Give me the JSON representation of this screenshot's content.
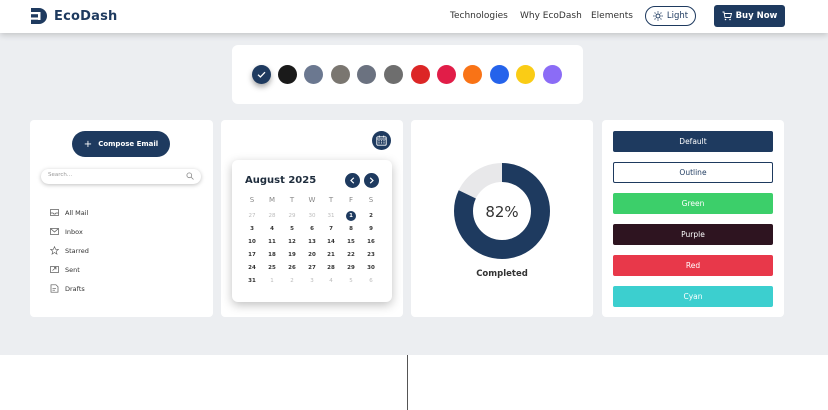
{
  "brand": {
    "name": "EcoDash"
  },
  "nav": {
    "links": [
      "Technologies",
      "Why EcoDash",
      "Elements"
    ],
    "theme_toggle": "Light",
    "buy_button": "Buy Now"
  },
  "colors": {
    "primary": "#1e3a5f",
    "swatches": [
      "#1e3a5f",
      "#1a1a1a",
      "#6b7890",
      "#7a7670",
      "#6b7280",
      "#6e6e6e",
      "#dc2626",
      "#e11d48",
      "#f97316",
      "#2563eb",
      "#facc15",
      "#8b6cf6"
    ],
    "selected_swatch": 0
  },
  "mail": {
    "compose": "Compose Email",
    "search_placeholder": "Search...",
    "folders": [
      "All Mail",
      "Inbox",
      "Starred",
      "Sent",
      "Drafts"
    ]
  },
  "calendar": {
    "title": "August 2025",
    "weekdays": [
      "S",
      "M",
      "T",
      "W",
      "T",
      "F",
      "S"
    ],
    "selected_day": "1",
    "weeks": [
      [
        "27",
        "28",
        "29",
        "30",
        "31",
        "1",
        "2"
      ],
      [
        "3",
        "4",
        "5",
        "6",
        "7",
        "8",
        "9"
      ],
      [
        "10",
        "11",
        "12",
        "13",
        "14",
        "15",
        "16"
      ],
      [
        "17",
        "18",
        "19",
        "20",
        "21",
        "22",
        "23"
      ],
      [
        "24",
        "25",
        "26",
        "27",
        "28",
        "29",
        "30"
      ],
      [
        "31",
        "1",
        "2",
        "3",
        "4",
        "5",
        "6"
      ]
    ]
  },
  "progress": {
    "value": 82,
    "label": "82%",
    "caption": "Completed"
  },
  "buttons": [
    {
      "label": "Default",
      "color": "#1e3a5f",
      "style": "solid"
    },
    {
      "label": "Outline",
      "color": "#1e3a5f",
      "style": "outline"
    },
    {
      "label": "Green",
      "color": "#3ccf6a",
      "style": "solid"
    },
    {
      "label": "Purple",
      "color": "#2e1420",
      "style": "solid"
    },
    {
      "label": "Red",
      "color": "#e8384a",
      "style": "solid"
    },
    {
      "label": "Cyan",
      "color": "#3ccfcf",
      "style": "solid"
    }
  ]
}
